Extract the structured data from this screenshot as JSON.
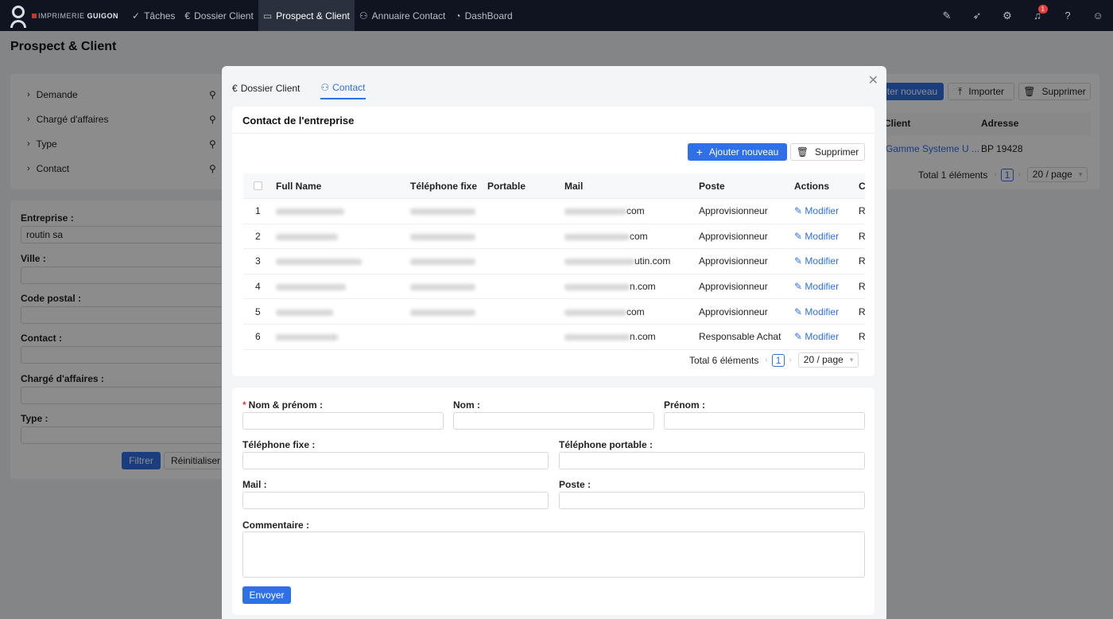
{
  "app": {
    "brand_prefix": "IMPRIMERIE",
    "brand_name": "GUIGON",
    "nav": [
      {
        "label": "Tâches",
        "icon": "check-icon"
      },
      {
        "label": "Dossier Client",
        "icon": "euro-circle-icon"
      },
      {
        "label": "Prospect & Client",
        "icon": "id-card-icon",
        "active": true
      },
      {
        "label": "Annuaire Contact",
        "icon": "users-icon"
      },
      {
        "label": "DashBoard",
        "icon": "dashboard-icon"
      }
    ],
    "notification_count": "1"
  },
  "page": {
    "title": "Prospect & Client",
    "tree": [
      "Demande",
      "Chargé d'affaires",
      "Type",
      "Contact"
    ],
    "filters": {
      "entreprise_label": "Entreprise :",
      "entreprise_value": "routin sa",
      "ville_label": "Ville :",
      "code_postal_label": "Code postal :",
      "contact_label": "Contact :",
      "charge_label": "Chargé d'affaires :",
      "type_label": "Type :",
      "filter_btn": "Filtrer",
      "reset_btn": "Réinitialiser"
    },
    "right": {
      "add_btn": "ter nouveau",
      "import_btn": "Importer",
      "delete_btn": "Supprimer",
      "col_client": "Client",
      "col_adresse": "Adresse",
      "row_client": "Gamme Systeme U ...",
      "row_adresse": "BP 19428",
      "total": "Total 1 éléments",
      "page": "1",
      "page_size": "20 / page"
    }
  },
  "modal": {
    "tabs": [
      {
        "label": "Dossier Client",
        "icon": "euro-circle-icon"
      },
      {
        "label": "Contact",
        "icon": "users-icon",
        "active": true
      }
    ],
    "card_title": "Contact de l'entreprise",
    "add_btn": "Ajouter nouveau",
    "delete_btn": "Supprimer",
    "columns": [
      "Full Name",
      "Téléphone fixe",
      "Portable",
      "Mail",
      "Poste",
      "Actions",
      "C"
    ],
    "rows": [
      {
        "n": "1",
        "mail_suffix": "com",
        "poste": "Approvisionneur",
        "action": "Modifier",
        "c": "R"
      },
      {
        "n": "2",
        "mail_suffix": "com",
        "poste": "Approvisionneur",
        "action": "Modifier",
        "c": "R"
      },
      {
        "n": "3",
        "mail_suffix": "utin.com",
        "poste": "Approvisionneur",
        "action": "Modifier",
        "c": "R"
      },
      {
        "n": "4",
        "mail_suffix": "n.com",
        "poste": "Approvisionneur",
        "action": "Modifier",
        "c": "R"
      },
      {
        "n": "5",
        "mail_suffix": "com",
        "poste": "Approvisionneur",
        "action": "Modifier",
        "c": "R"
      },
      {
        "n": "6",
        "mail_suffix": "n.com",
        "poste": "Responsable Achat",
        "action": "Modifier",
        "c": "R"
      }
    ],
    "total": "Total 6 éléments",
    "page": "1",
    "page_size": "20 / page",
    "form": {
      "nom_prenom": "Nom & prénom :",
      "nom": "Nom :",
      "prenom": "Prénom :",
      "tel_fixe": "Téléphone fixe :",
      "tel_portable": "Téléphone portable :",
      "mail": "Mail :",
      "poste": "Poste :",
      "commentaire": "Commentaire :",
      "submit": "Envoyer"
    }
  }
}
